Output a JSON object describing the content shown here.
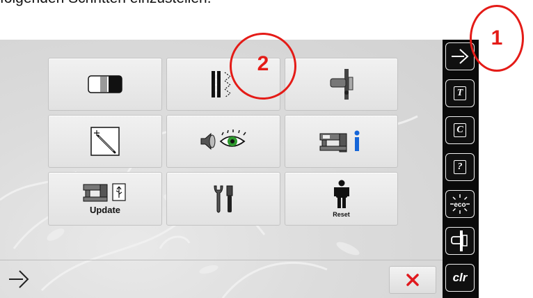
{
  "caption": "folgenden Schritten einzustellen.",
  "annotations": {
    "one": "1",
    "two": "2"
  },
  "tiles": {
    "update_label": "Update",
    "reset_label": "Reset"
  },
  "sidebar": {
    "clr_label": "clr",
    "text_icon_letter": "T",
    "cursor_icon_letter": "C",
    "help_icon_letter": "?",
    "eco_label": "eco"
  },
  "colors": {
    "annotation": "#e41b17",
    "close_x": "#e0191e",
    "info_i": "#1565d8",
    "eye_iris": "#2e9a2e",
    "sidebar_bg": "#0a0a0a"
  },
  "icons": [
    "screen-contrast-icon",
    "stitch-needle-position-icon",
    "presser-foot-icon",
    "touchscreen-calibration-icon",
    "sound-and-display-icon",
    "machine-info-icon",
    "machine-usb-update-icon",
    "service-tools-icon",
    "person-reset-icon",
    "home-arrow-icon",
    "text-icon",
    "cursor-icon",
    "help-icon",
    "eco-icon",
    "presser-foot-mode-icon",
    "close-x-icon",
    "back-arrow-icon"
  ]
}
